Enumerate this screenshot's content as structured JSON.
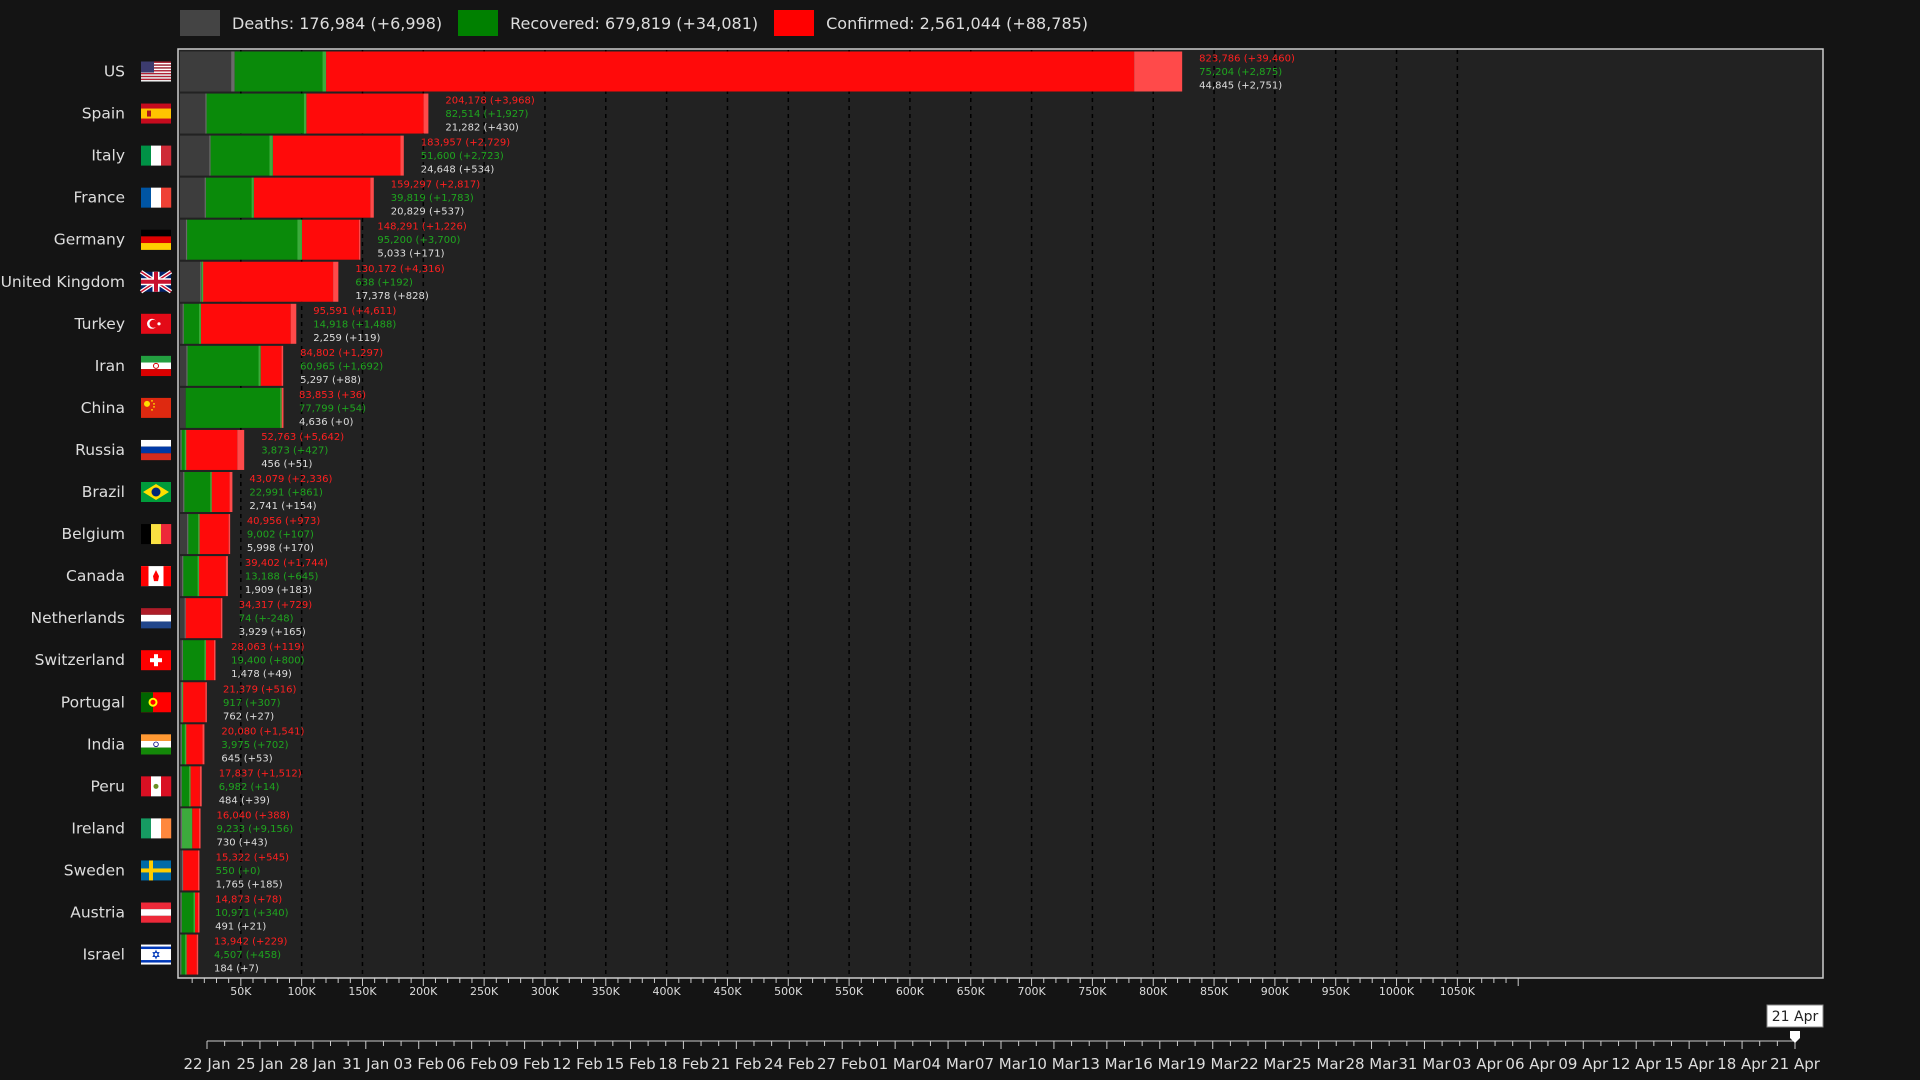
{
  "legend": {
    "deaths": {
      "label": "Deaths: 176,984 (+6,998)",
      "color": "#444444"
    },
    "recovered": {
      "label": "Recovered: 679,819 (+34,081)",
      "color": "#008000"
    },
    "confirmed": {
      "label": "Confirmed: 2,561,044 (+88,785)",
      "color": "#ff0000"
    }
  },
  "chart_data": {
    "type": "bar",
    "orientation": "horizontal",
    "stacked": true,
    "xlim": [
      0,
      1100000
    ],
    "x_ticks": [
      "50K",
      "100K",
      "150K",
      "200K",
      "250K",
      "300K",
      "350K",
      "400K",
      "450K",
      "500K",
      "550K",
      "600K",
      "650K",
      "700K",
      "750K",
      "800K",
      "850K",
      "900K",
      "950K",
      "1000K",
      "1050K"
    ],
    "grid": true,
    "legend_position": "top",
    "colors": {
      "deaths": "#3d3d3d",
      "recovered": "#0a8a0a",
      "confirmed": "#ff0a0a",
      "new_confirmed": "#ff4a4a"
    },
    "rows": [
      {
        "country": "US",
        "flag": "us-flag",
        "confirmed": 823786,
        "confirmed_new": 39460,
        "recovered": 75204,
        "recovered_new": 2875,
        "deaths": 44845,
        "deaths_new": 2751,
        "confirmed_label": "823,786 (+39,460)",
        "recovered_label": "75,204 (+2,875)",
        "deaths_label": "44,845 (+2,751)"
      },
      {
        "country": "Spain",
        "flag": "spain-flag",
        "confirmed": 204178,
        "confirmed_new": 3968,
        "recovered": 82514,
        "recovered_new": 1927,
        "deaths": 21282,
        "deaths_new": 430,
        "confirmed_label": "204,178 (+3,968)",
        "recovered_label": "82,514 (+1,927)",
        "deaths_label": "21,282 (+430)"
      },
      {
        "country": "Italy",
        "flag": "italy-flag",
        "confirmed": 183957,
        "confirmed_new": 2729,
        "recovered": 51600,
        "recovered_new": 2723,
        "deaths": 24648,
        "deaths_new": 534,
        "confirmed_label": "183,957 (+2,729)",
        "recovered_label": "51,600 (+2,723)",
        "deaths_label": "24,648 (+534)"
      },
      {
        "country": "France",
        "flag": "france-flag",
        "confirmed": 159297,
        "confirmed_new": 2817,
        "recovered": 39819,
        "recovered_new": 1783,
        "deaths": 20829,
        "deaths_new": 537,
        "confirmed_label": "159,297 (+2,817)",
        "recovered_label": "39,819 (+1,783)",
        "deaths_label": "20,829 (+537)"
      },
      {
        "country": "Germany",
        "flag": "germany-flag",
        "confirmed": 148291,
        "confirmed_new": 1226,
        "recovered": 95200,
        "recovered_new": 3700,
        "deaths": 5033,
        "deaths_new": 171,
        "confirmed_label": "148,291 (+1,226)",
        "recovered_label": "95,200 (+3,700)",
        "deaths_label": "5,033 (+171)"
      },
      {
        "country": "United Kingdom",
        "flag": "uk-flag",
        "confirmed": 130172,
        "confirmed_new": 4316,
        "recovered": 638,
        "recovered_new": 192,
        "deaths": 17378,
        "deaths_new": 828,
        "confirmed_label": "130,172 (+4,316)",
        "recovered_label": "638 (+192)",
        "deaths_label": "17,378 (+828)"
      },
      {
        "country": "Turkey",
        "flag": "turkey-flag",
        "confirmed": 95591,
        "confirmed_new": 4611,
        "recovered": 14918,
        "recovered_new": 1488,
        "deaths": 2259,
        "deaths_new": 119,
        "confirmed_label": "95,591 (+4,611)",
        "recovered_label": "14,918 (+1,488)",
        "deaths_label": "2,259 (+119)"
      },
      {
        "country": "Iran",
        "flag": "iran-flag",
        "confirmed": 84802,
        "confirmed_new": 1297,
        "recovered": 60965,
        "recovered_new": 1692,
        "deaths": 5297,
        "deaths_new": 88,
        "confirmed_label": "84,802 (+1,297)",
        "recovered_label": "60,965 (+1,692)",
        "deaths_label": "5,297 (+88)"
      },
      {
        "country": "China",
        "flag": "china-flag",
        "confirmed": 83853,
        "confirmed_new": 36,
        "recovered": 77799,
        "recovered_new": 54,
        "deaths": 4636,
        "deaths_new": 0,
        "confirmed_label": "83,853 (+36)",
        "recovered_label": "77,799 (+54)",
        "deaths_label": "4,636 (+0)"
      },
      {
        "country": "Russia",
        "flag": "russia-flag",
        "confirmed": 52763,
        "confirmed_new": 5642,
        "recovered": 3873,
        "recovered_new": 427,
        "deaths": 456,
        "deaths_new": 51,
        "confirmed_label": "52,763 (+5,642)",
        "recovered_label": "3,873 (+427)",
        "deaths_label": "456 (+51)"
      },
      {
        "country": "Brazil",
        "flag": "brazil-flag",
        "confirmed": 43079,
        "confirmed_new": 2336,
        "recovered": 22991,
        "recovered_new": 861,
        "deaths": 2741,
        "deaths_new": 154,
        "confirmed_label": "43,079 (+2,336)",
        "recovered_label": "22,991 (+861)",
        "deaths_label": "2,741 (+154)"
      },
      {
        "country": "Belgium",
        "flag": "belgium-flag",
        "confirmed": 40956,
        "confirmed_new": 973,
        "recovered": 9002,
        "recovered_new": 107,
        "deaths": 5998,
        "deaths_new": 170,
        "confirmed_label": "40,956 (+973)",
        "recovered_label": "9,002 (+107)",
        "deaths_label": "5,998 (+170)"
      },
      {
        "country": "Canada",
        "flag": "canada-flag",
        "confirmed": 39402,
        "confirmed_new": 1744,
        "recovered": 13188,
        "recovered_new": 645,
        "deaths": 1909,
        "deaths_new": 183,
        "confirmed_label": "39,402 (+1,744)",
        "recovered_label": "13,188 (+645)",
        "deaths_label": "1,909 (+183)"
      },
      {
        "country": "Netherlands",
        "flag": "netherlands-flag",
        "confirmed": 34317,
        "confirmed_new": 729,
        "recovered": 74,
        "recovered_new": -248,
        "deaths": 3929,
        "deaths_new": 165,
        "confirmed_label": "34,317 (+729)",
        "recovered_label": "74 (+-248)",
        "deaths_label": "3,929 (+165)"
      },
      {
        "country": "Switzerland",
        "flag": "switzerland-flag",
        "confirmed": 28063,
        "confirmed_new": 119,
        "recovered": 19400,
        "recovered_new": 800,
        "deaths": 1478,
        "deaths_new": 49,
        "confirmed_label": "28,063 (+119)",
        "recovered_label": "19,400 (+800)",
        "deaths_label": "1,478 (+49)"
      },
      {
        "country": "Portugal",
        "flag": "portugal-flag",
        "confirmed": 21379,
        "confirmed_new": 516,
        "recovered": 917,
        "recovered_new": 307,
        "deaths": 762,
        "deaths_new": 27,
        "confirmed_label": "21,379 (+516)",
        "recovered_label": "917 (+307)",
        "deaths_label": "762 (+27)"
      },
      {
        "country": "India",
        "flag": "india-flag",
        "confirmed": 20080,
        "confirmed_new": 1541,
        "recovered": 3975,
        "recovered_new": 702,
        "deaths": 645,
        "deaths_new": 53,
        "confirmed_label": "20,080 (+1,541)",
        "recovered_label": "3,975 (+702)",
        "deaths_label": "645 (+53)"
      },
      {
        "country": "Peru",
        "flag": "peru-flag",
        "confirmed": 17837,
        "confirmed_new": 1512,
        "recovered": 6982,
        "recovered_new": 14,
        "deaths": 484,
        "deaths_new": 39,
        "confirmed_label": "17,837 (+1,512)",
        "recovered_label": "6,982 (+14)",
        "deaths_label": "484 (+39)"
      },
      {
        "country": "Ireland",
        "flag": "ireland-flag",
        "confirmed": 16040,
        "confirmed_new": 388,
        "recovered": 9233,
        "recovered_new": 9156,
        "deaths": 730,
        "deaths_new": 43,
        "confirmed_label": "16,040 (+388)",
        "recovered_label": "9,233 (+9,156)",
        "deaths_label": "730 (+43)"
      },
      {
        "country": "Sweden",
        "flag": "sweden-flag",
        "confirmed": 15322,
        "confirmed_new": 545,
        "recovered": 550,
        "recovered_new": 0,
        "deaths": 1765,
        "deaths_new": 185,
        "confirmed_label": "15,322 (+545)",
        "recovered_label": "550 (+0)",
        "deaths_label": "1,765 (+185)"
      },
      {
        "country": "Austria",
        "flag": "austria-flag",
        "confirmed": 14873,
        "confirmed_new": 78,
        "recovered": 10971,
        "recovered_new": 340,
        "deaths": 491,
        "deaths_new": 21,
        "confirmed_label": "14,873 (+78)",
        "recovered_label": "10,971 (+340)",
        "deaths_label": "491 (+21)"
      },
      {
        "country": "Israel",
        "flag": "israel-flag",
        "confirmed": 13942,
        "confirmed_new": 229,
        "recovered": 4507,
        "recovered_new": 458,
        "deaths": 184,
        "deaths_new": 7,
        "confirmed_label": "13,942 (+229)",
        "recovered_label": "4,507 (+458)",
        "deaths_label": "184 (+7)"
      }
    ]
  },
  "timeline": {
    "dates": [
      "22 Jan",
      "25 Jan",
      "28 Jan",
      "31 Jan",
      "03 Feb",
      "06 Feb",
      "09 Feb",
      "12 Feb",
      "15 Feb",
      "18 Feb",
      "21 Feb",
      "24 Feb",
      "27 Feb",
      "01 Mar",
      "04 Mar",
      "07 Mar",
      "10 Mar",
      "13 Mar",
      "16 Mar",
      "19 Mar",
      "22 Mar",
      "25 Mar",
      "28 Mar",
      "31 Mar",
      "03 Apr",
      "06 Apr",
      "09 Apr",
      "12 Apr",
      "15 Apr",
      "18 Apr",
      "21 Apr"
    ],
    "current": "21 Apr",
    "total_days": 90
  }
}
